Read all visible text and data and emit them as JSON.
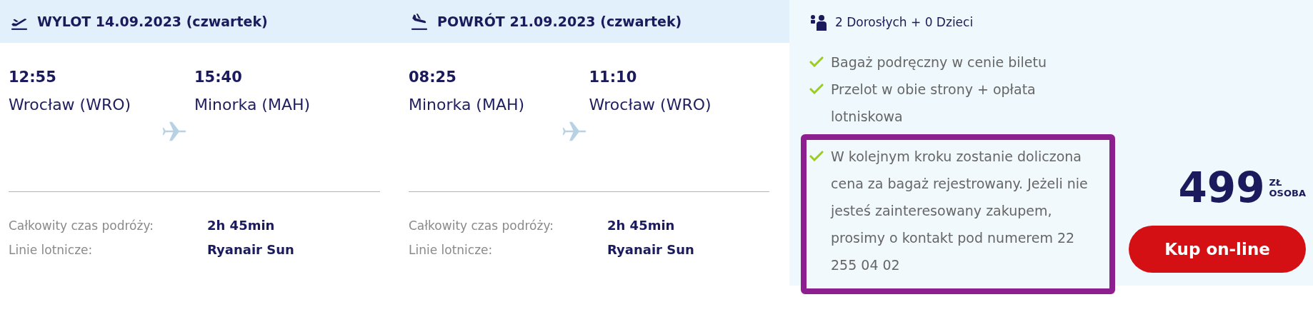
{
  "flights": [
    {
      "kind": "departure",
      "title": "WYLOT 14.09.2023 (czwartek)",
      "from": {
        "time": "12:55",
        "place": "Wrocław (WRO)"
      },
      "to": {
        "time": "15:40",
        "place": "Minorka (MAH)"
      },
      "details": [
        {
          "label": "Całkowity czas podróży:",
          "value": "2h 45min"
        },
        {
          "label": "Linie lotnicze:",
          "value": "Ryanair Sun"
        }
      ]
    },
    {
      "kind": "return",
      "title": "POWRÓT 21.09.2023 (czwartek)",
      "from": {
        "time": "08:25",
        "place": "Minorka (MAH)"
      },
      "to": {
        "time": "11:10",
        "place": "Wrocław (WRO)"
      },
      "details": [
        {
          "label": "Całkowity czas podróży:",
          "value": "2h 45min"
        },
        {
          "label": "Linie lotnicze:",
          "value": "Ryanair Sun"
        }
      ]
    }
  ],
  "summary": {
    "passengers": "2 Dorosłych + 0 Dzieci",
    "features": [
      {
        "text": "Bagaż podręczny w cenie biletu",
        "highlighted": false
      },
      {
        "text": "Przelot w obie strony + opłata lotniskowa",
        "highlighted": false
      },
      {
        "text": "W kolejnym kroku zostanie doliczona cena za bagaż rejestrowany. Jeżeli nie jesteś zainteresowany zakupem, prosimy o kontakt pod numerem 22 255 04 02",
        "highlighted": true
      }
    ],
    "price": "499",
    "currency": "ZŁ",
    "per": "OSOBA",
    "buy_button": "Kup on-line"
  }
}
